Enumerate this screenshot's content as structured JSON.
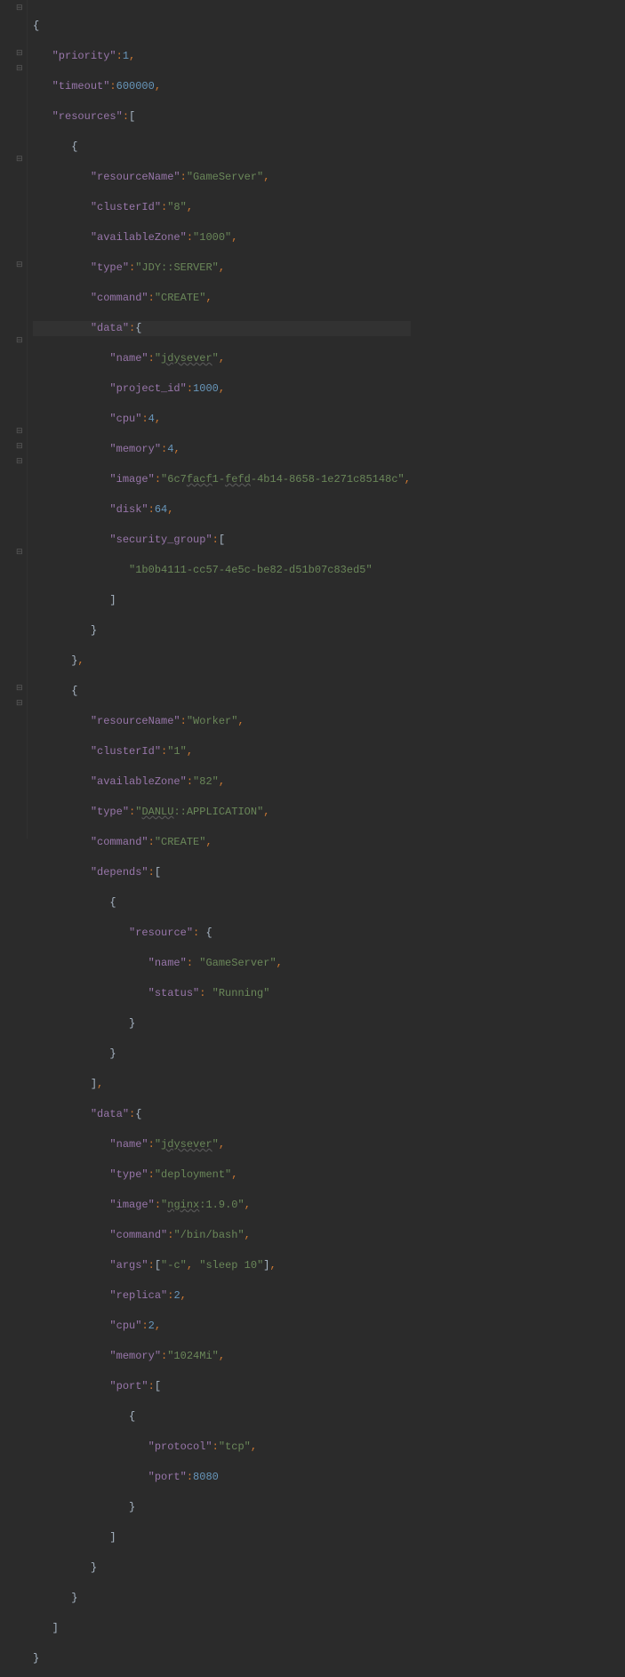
{
  "code": {
    "root": {
      "priority_key": "\"priority\"",
      "priority_val": "1",
      "timeout_key": "\"timeout\"",
      "timeout_val": "600000",
      "resources_key": "\"resources\""
    },
    "res0": {
      "resourceName_key": "\"resourceName\"",
      "resourceName_val": "\"GameServer\"",
      "clusterId_key": "\"clusterId\"",
      "clusterId_val": "\"8\"",
      "availableZone_key": "\"availableZone\"",
      "availableZone_val": "\"1000\"",
      "type_key": "\"type\"",
      "type_val": "\"JDY::SERVER\"",
      "command_key": "\"command\"",
      "command_val": "\"CREATE\"",
      "data_key": "\"data\"",
      "data": {
        "name_key": "\"name\"",
        "name_val_pre": "\"",
        "name_val_u": "jdysever",
        "name_val_post": "\"",
        "project_id_key": "\"project_id\"",
        "project_id_val": "1000",
        "cpu_key": "\"cpu\"",
        "cpu_val": "4",
        "memory_key": "\"memory\"",
        "memory_val": "4",
        "image_key": "\"image\"",
        "image_val_pre": "\"6c7",
        "image_val_u1": "facf",
        "image_val_mid": "1-",
        "image_val_u2": "fefd",
        "image_val_post": "-4b14-8658-1e271c85148c\"",
        "disk_key": "\"disk\"",
        "disk_val": "64",
        "security_group_key": "\"security_group\"",
        "security_group_val": "\"1b0b4111-cc57-4e5c-be82-d51b07c83ed5\""
      }
    },
    "res1": {
      "resourceName_key": "\"resourceName\"",
      "resourceName_val": "\"Worker\"",
      "clusterId_key": "\"clusterId\"",
      "clusterId_val": "\"1\"",
      "availableZone_key": "\"availableZone\"",
      "availableZone_val": "\"82\"",
      "type_key": "\"type\"",
      "type_val_pre": "\"",
      "type_val_u": "DANLU",
      "type_val_post": "::APPLICATION\"",
      "command_key": "\"command\"",
      "command_val": "\"CREATE\"",
      "depends_key": "\"depends\"",
      "depends": {
        "resource_key": "\"resource\"",
        "name_key": "\"name\"",
        "name_val": "\"GameServer\"",
        "status_key": "\"status\"",
        "status_val": "\"Running\""
      },
      "data_key": "\"data\"",
      "data": {
        "name_key": "\"name\"",
        "name_val_pre": "\"",
        "name_val_u": "jdysever",
        "name_val_post": "\"",
        "type_key": "\"type\"",
        "type_val": "\"deployment\"",
        "image_key": "\"image\"",
        "image_val_pre": "\"",
        "image_val_u": "nginx",
        "image_val_post": ":1.9.0\"",
        "command_key": "\"command\"",
        "command_val": "\"/bin/bash\"",
        "args_key": "\"args\"",
        "args_val0": "\"-c\"",
        "args_val1": "\"sleep 10\"",
        "replica_key": "\"replica\"",
        "replica_val": "2",
        "cpu_key": "\"cpu\"",
        "cpu_val": "2",
        "memory_key": "\"memory\"",
        "memory_val": "\"1024Mi\"",
        "port_key": "\"port\"",
        "port": {
          "protocol_key": "\"protocol\"",
          "protocol_val": "\"tcp\"",
          "port_key": "\"port\"",
          "port_val": "8080"
        }
      }
    }
  },
  "fold_glyph_open": "⊟"
}
